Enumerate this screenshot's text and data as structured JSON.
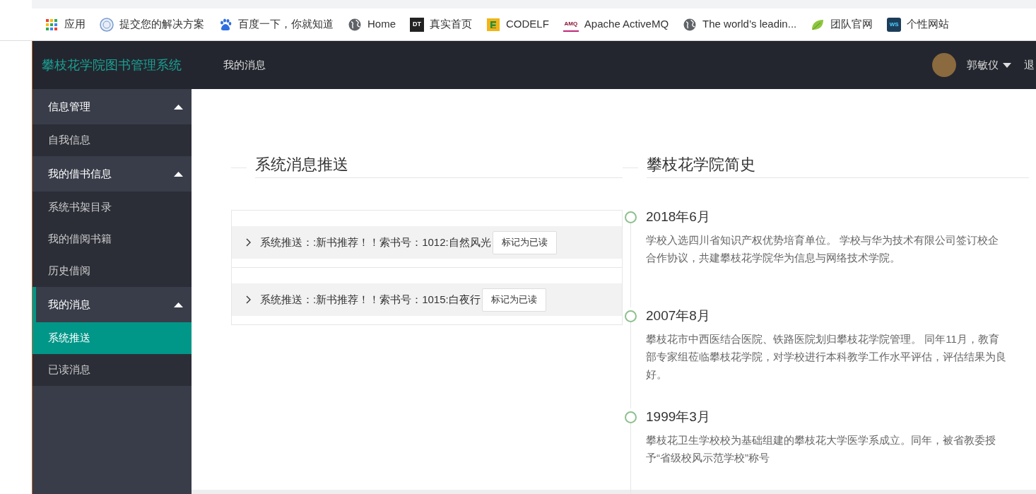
{
  "bookmarks": [
    {
      "label": "应用",
      "kind": "apps"
    },
    {
      "label": "提交您的解决方案",
      "kind": "emblem"
    },
    {
      "label": "百度一下，你就知道",
      "kind": "paw"
    },
    {
      "label": "Home",
      "kind": "globe"
    },
    {
      "label": "真实首页",
      "kind": "badge",
      "icon_text": "DT"
    },
    {
      "label": "CODELF",
      "kind": "blocks"
    },
    {
      "label": "Apache ActiveMQ",
      "kind": "amq",
      "icon_text": "AMQ"
    },
    {
      "label": "The world’s leadin...",
      "kind": "globe"
    },
    {
      "label": "团队官网",
      "kind": "leaf"
    },
    {
      "label": "个性网站",
      "kind": "ws",
      "icon_text": "WS"
    }
  ],
  "header": {
    "title": "攀枝花学院图书管理系统",
    "nav": [
      {
        "label": "我的消息",
        "selected": false
      }
    ],
    "user": "郭敏仪",
    "logout": "退"
  },
  "sidebar": {
    "groups": [
      {
        "label": "信息管理",
        "expanded": true,
        "selected": false,
        "children": [
          {
            "label": "自我信息",
            "selected": false
          }
        ]
      },
      {
        "label": "我的借书信息",
        "expanded": true,
        "selected": false,
        "children": [
          {
            "label": "系统书架目录",
            "selected": false
          },
          {
            "label": "我的借阅书籍",
            "selected": false
          },
          {
            "label": "历史借阅",
            "selected": false
          }
        ]
      },
      {
        "label": "我的消息",
        "expanded": true,
        "selected": true,
        "children": [
          {
            "label": "系统推送",
            "selected": true
          },
          {
            "label": "已读消息",
            "selected": false
          }
        ]
      }
    ]
  },
  "messages": {
    "title": "系统消息推送",
    "items": [
      {
        "text": "系统推送：:新书推荐！！索书号：1012:自然风光",
        "button": "标记为已读",
        "expanded": false
      },
      {
        "text": "系统推送：:新书推荐！！索书号：1015:白夜行",
        "button": "标记为已读",
        "expanded": false
      }
    ]
  },
  "history": {
    "title": "攀枝花学院简史",
    "items": [
      {
        "date": "2018年6月",
        "text": "学校入选四川省知识产权优势培育单位。 学校与华为技术有限公司签订校企合作协议，共建攀枝花学院华为信息与网络技术学院。"
      },
      {
        "date": "2007年8月",
        "text": "攀枝花市中西医结合医院、铁路医院划归攀枝花学院管理。 同年11月，教育部专家组莅临攀枝花学院，对学校进行本科教学工作水平评估，评估结果为良好。"
      },
      {
        "date": "1999年3月",
        "text": "攀枝花卫生学校校为基础组建的攀枝花大学医学系成立。同年，被省教委授予“省级校风示范学校”称号"
      }
    ]
  }
}
